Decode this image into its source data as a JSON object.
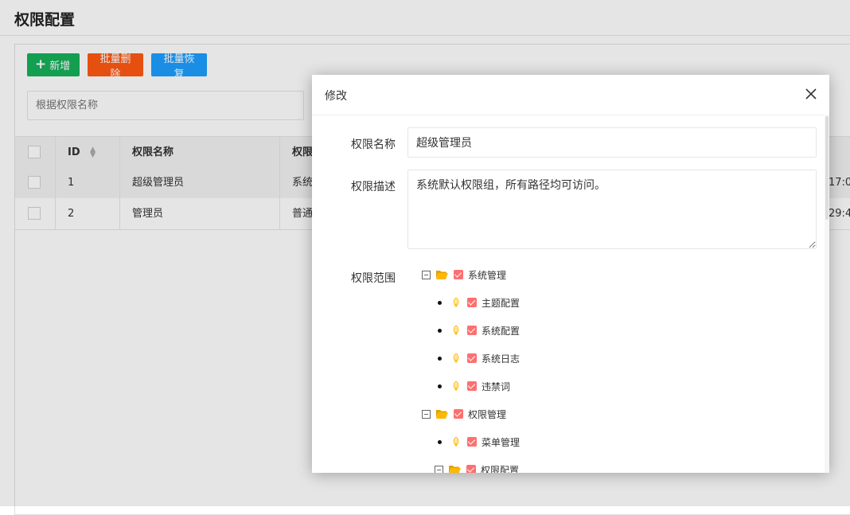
{
  "page": {
    "title": "权限配置"
  },
  "toolbar": {
    "add_label": "新增",
    "batch_delete_label": "批量删除",
    "batch_restore_label": "批量恢复",
    "add_color": "#16b05a",
    "delete_color": "#ff5a14",
    "restore_color": "#1e9fff"
  },
  "search": {
    "placeholder": "根据权限名称"
  },
  "table": {
    "headers": {
      "id": "ID",
      "name": "权限名称",
      "desc": "权限"
    },
    "rows": [
      {
        "id": "1",
        "name": "超级管理员",
        "desc": "系统",
        "time": "17:0"
      },
      {
        "id": "2",
        "name": "管理员",
        "desc": "普通",
        "time": "29:4"
      }
    ]
  },
  "modal": {
    "title": "修改",
    "fields": {
      "name_label": "权限名称",
      "name_value": "超级管理员",
      "desc_label": "权限描述",
      "desc_value": "系统默认权限组，所有路径均可访问。",
      "scope_label": "权限范围"
    },
    "tree": [
      {
        "label": "系统管理",
        "type": "folder",
        "expanded": true,
        "checked": true
      },
      {
        "label": "主题配置",
        "type": "leaf",
        "checked": true
      },
      {
        "label": "系统配置",
        "type": "leaf",
        "checked": true
      },
      {
        "label": "系统日志",
        "type": "leaf",
        "checked": true
      },
      {
        "label": "违禁词",
        "type": "leaf",
        "checked": true
      },
      {
        "label": "权限管理",
        "type": "folder",
        "expanded": true,
        "checked": true
      },
      {
        "label": "菜单管理",
        "type": "leaf",
        "checked": true
      },
      {
        "label": "权限配置",
        "type": "folder",
        "expanded": true,
        "checked": true
      }
    ],
    "check_color": "#ff6f6f",
    "folder_color": "#ffb800"
  }
}
